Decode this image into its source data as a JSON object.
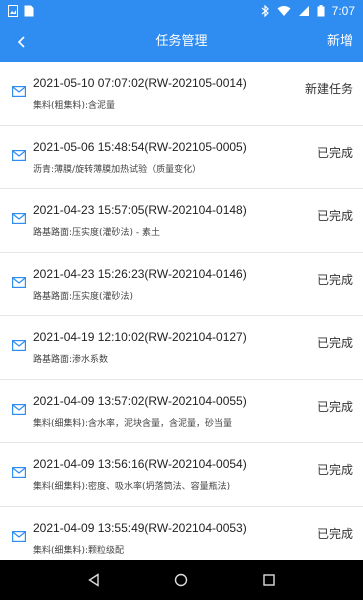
{
  "status_bar": {
    "time": "7:07"
  },
  "header": {
    "title": "任务管理",
    "add_label": "新增"
  },
  "tasks": [
    {
      "id": "2021-05-10 07:07:02(RW-202105-0014)",
      "desc": "集料(粗集料):含泥量",
      "status": "新建任务"
    },
    {
      "id": "2021-05-06 15:48:54(RW-202105-0005)",
      "desc": "沥青:薄膜/旋转薄膜加热试验（质量变化）",
      "status": "已完成"
    },
    {
      "id": "2021-04-23 15:57:05(RW-202104-0148)",
      "desc": "路基路面:压实度(灌砂法) - 素土",
      "status": "已完成"
    },
    {
      "id": "2021-04-23 15:26:23(RW-202104-0146)",
      "desc": "路基路面:压实度(灌砂法)",
      "status": "已完成"
    },
    {
      "id": "2021-04-19 12:10:02(RW-202104-0127)",
      "desc": "路基路面:渗水系数",
      "status": "已完成"
    },
    {
      "id": "2021-04-09 13:57:02(RW-202104-0055)",
      "desc": "集料(细集料):含水率，泥块含量，含泥量，砂当量",
      "status": "已完成"
    },
    {
      "id": "2021-04-09 13:56:16(RW-202104-0054)",
      "desc": "集料(细集料):密度、吸水率(坍落筒法、容量瓶法)",
      "status": "已完成"
    },
    {
      "id": "2021-04-09 13:55:49(RW-202104-0053)",
      "desc": "集料(细集料):颗粒级配",
      "status": "已完成"
    }
  ],
  "colors": {
    "accent": "#2f8cf0",
    "icon": "#2f8cf0"
  }
}
